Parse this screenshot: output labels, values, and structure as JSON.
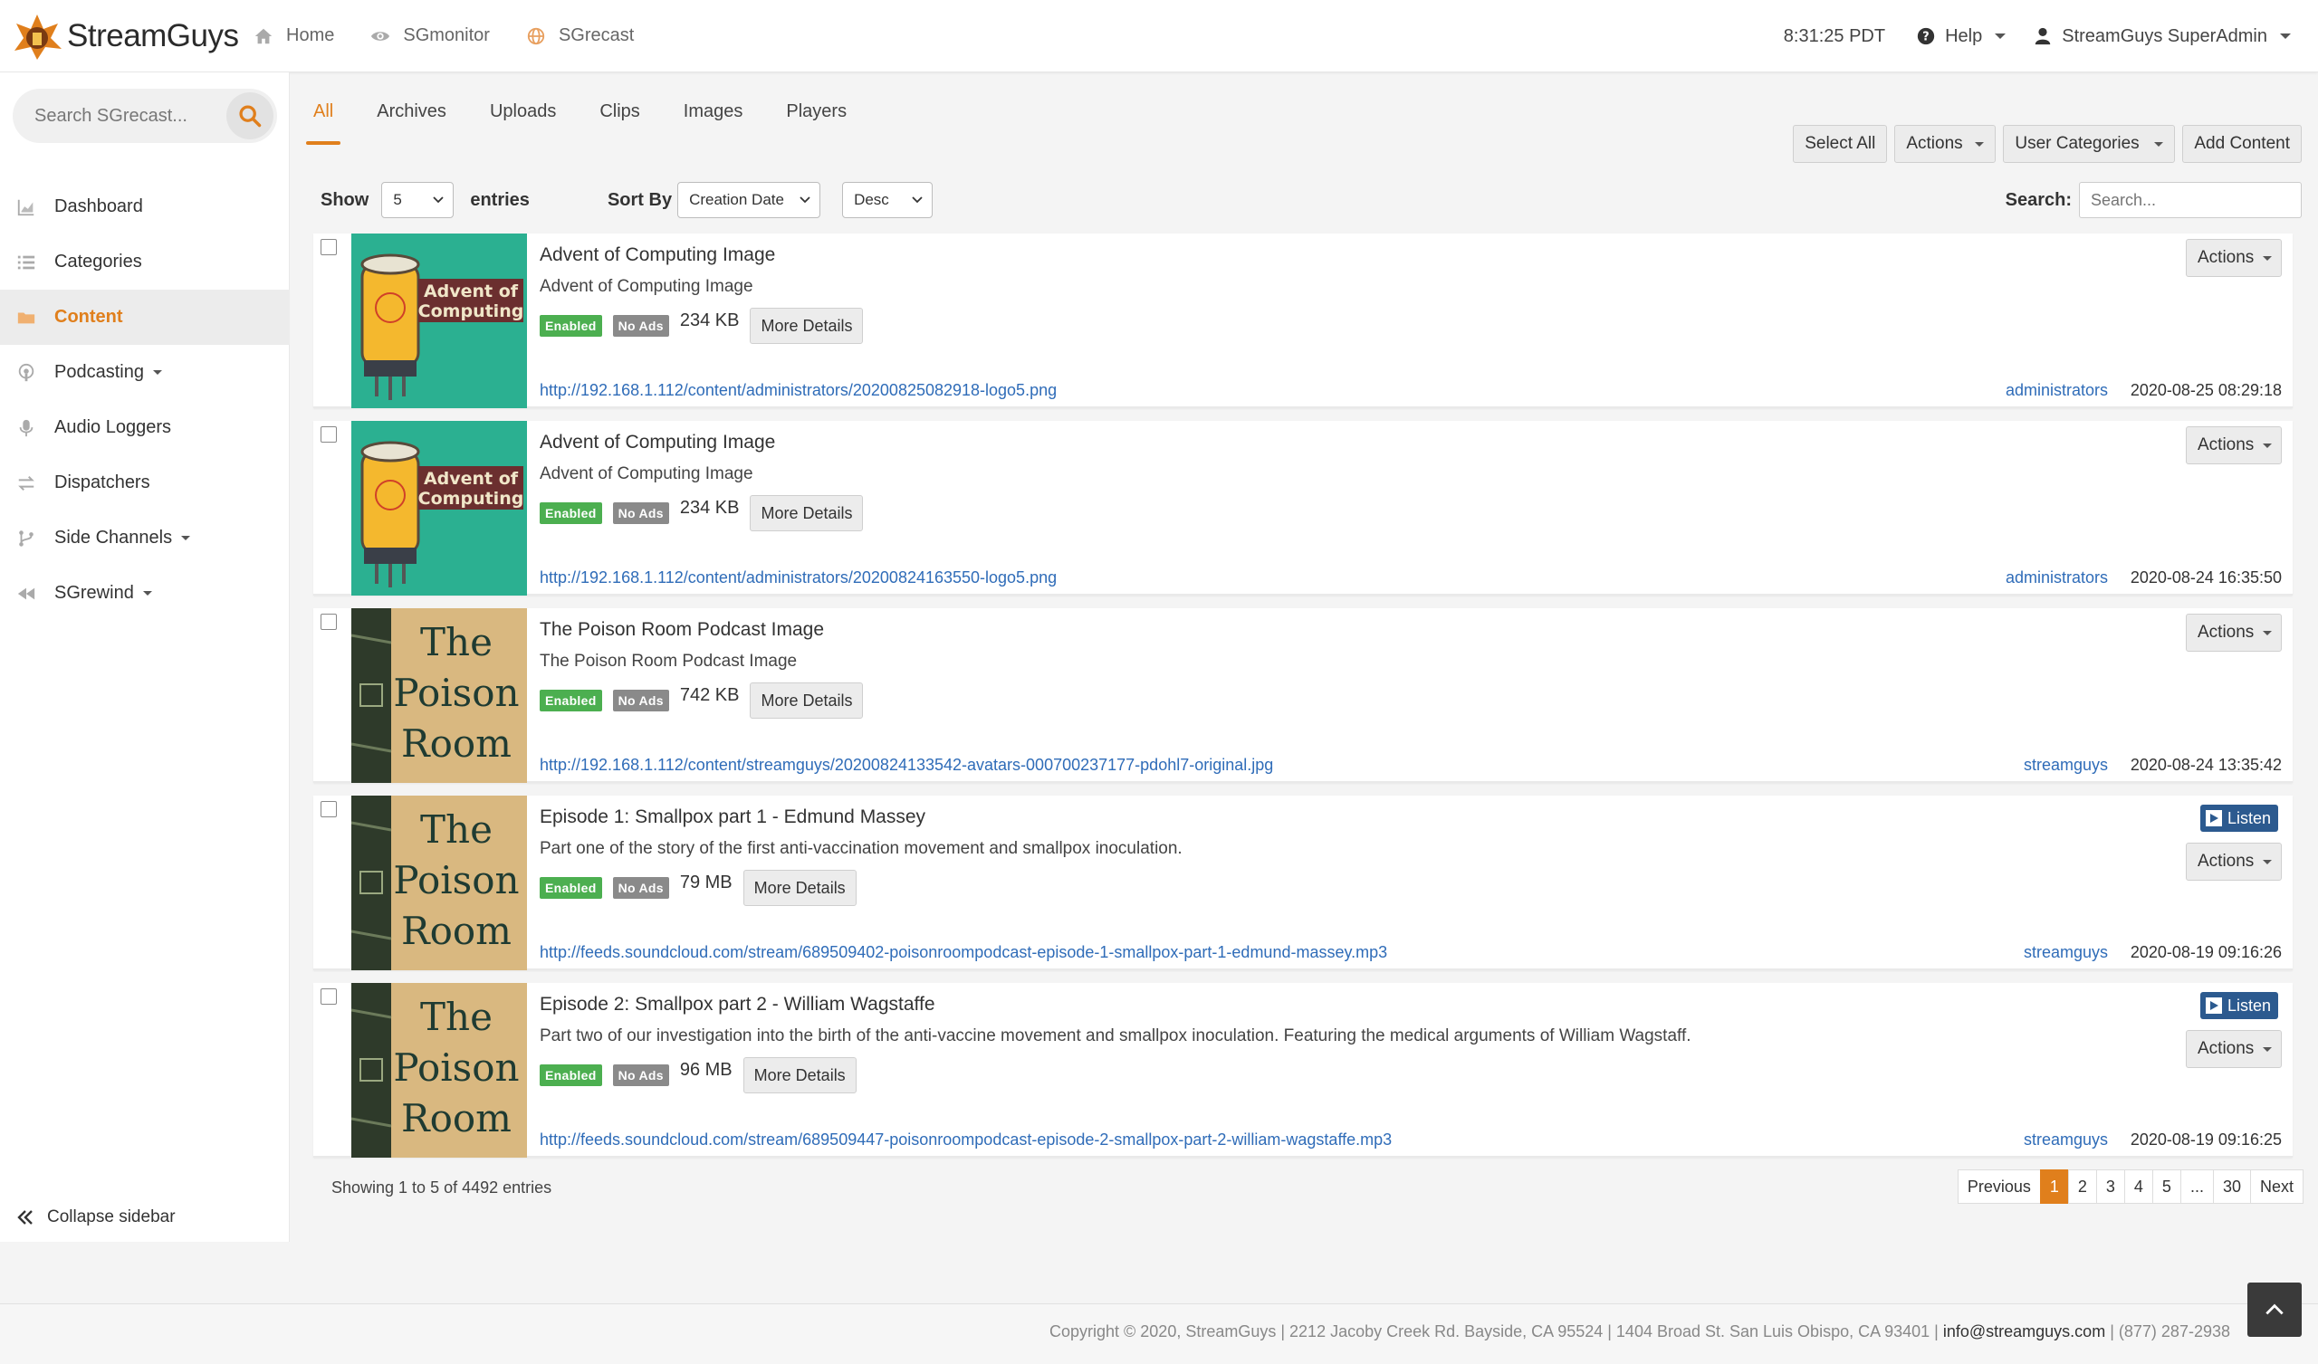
{
  "app": {
    "brand": "StreamGuys"
  },
  "topnav": [
    {
      "label": "Home",
      "icon": "home-icon"
    },
    {
      "label": "SGmonitor",
      "icon": "eye-icon"
    },
    {
      "label": "SGrecast",
      "icon": "globe-icon"
    }
  ],
  "topright": {
    "clock": "8:31:25 PDT",
    "help": "Help",
    "user": "StreamGuys SuperAdmin"
  },
  "sidebar": {
    "search_placeholder": "Search SGrecast...",
    "items": [
      {
        "label": "Dashboard",
        "icon": "chart-icon"
      },
      {
        "label": "Categories",
        "icon": "list-icon"
      },
      {
        "label": "Content",
        "icon": "folder-icon",
        "active": true
      },
      {
        "label": "Podcasting",
        "icon": "podcast-icon",
        "dropdown": true
      },
      {
        "label": "Audio Loggers",
        "icon": "microphone-icon"
      },
      {
        "label": "Dispatchers",
        "icon": "exchange-icon"
      },
      {
        "label": "Side Channels",
        "icon": "branch-icon",
        "dropdown": true
      },
      {
        "label": "SGrewind",
        "icon": "rewind-icon",
        "dropdown": true
      }
    ],
    "collapse_label": "Collapse sidebar"
  },
  "tabs": [
    "All",
    "Archives",
    "Uploads",
    "Clips",
    "Images",
    "Players"
  ],
  "toolbar": {
    "select_all": "Select All",
    "actions": "Actions",
    "user_categories": "User Categories",
    "add_content": "Add Content"
  },
  "filters": {
    "show_label": "Show",
    "show_value": "5",
    "entries_label": "entries",
    "sort_label": "Sort By",
    "sort_value": "Creation Date",
    "order_value": "Desc",
    "search_label": "Search:",
    "search_placeholder": "Search..."
  },
  "badges": {
    "enabled": "Enabled",
    "no_ads": "No Ads"
  },
  "labels": {
    "more_details": "More Details",
    "actions": "Actions",
    "listen": "Listen"
  },
  "thumbs": {
    "aoc_line1": "Advent of",
    "aoc_line2": "Computing",
    "pr_line1": "The",
    "pr_line2": "Poison",
    "pr_line3": "Room"
  },
  "rows": [
    {
      "title": "Advent of Computing Image",
      "desc": "Advent of Computing Image",
      "size": "234 KB",
      "url": "http://192.168.1.112/content/administrators/20200825082918-logo5.png",
      "owner": "administrators",
      "date": "2020-08-25 08:29:18"
    },
    {
      "title": "Advent of Computing Image",
      "desc": "Advent of Computing Image",
      "size": "234 KB",
      "url": "http://192.168.1.112/content/administrators/20200824163550-logo5.png",
      "owner": "administrators",
      "date": "2020-08-24 16:35:50"
    },
    {
      "title": "The Poison Room Podcast Image",
      "desc": "The Poison Room Podcast Image",
      "size": "742 KB",
      "url": "http://192.168.1.112/content/streamguys/20200824133542-avatars-000700237177-pdohl7-original.jpg",
      "owner": "streamguys",
      "date": "2020-08-24 13:35:42"
    },
    {
      "title": "Episode 1: Smallpox part 1 - Edmund Massey",
      "desc": "Part one of the story of the first anti-vaccination movement and smallpox inoculation.",
      "size": "79 MB",
      "url": "http://feeds.soundcloud.com/stream/689509402-poisonroompodcast-episode-1-smallpox-part-1-edmund-massey.mp3",
      "owner": "streamguys",
      "date": "2020-08-19 09:16:26"
    },
    {
      "title": "Episode 2: Smallpox part 2 - William Wagstaffe",
      "desc": "Part two of our investigation into the birth of the anti-vaccine movement and smallpox inoculation. Featuring the medical arguments of William Wagstaff.",
      "size": "96 MB",
      "url": "http://feeds.soundcloud.com/stream/689509447-poisonroompodcast-episode-2-smallpox-part-2-william-wagstaffe.mp3",
      "owner": "streamguys",
      "date": "2020-08-19 09:16:25"
    }
  ],
  "showing": "Showing 1 to 5 of 4492 entries",
  "pagination": {
    "previous": "Previous",
    "pages": [
      "1",
      "2",
      "3",
      "4",
      "5",
      "...",
      "30"
    ],
    "next": "Next",
    "current": "1"
  },
  "footer": {
    "copyright": "Copyright © 2020, StreamGuys | 2212 Jacoby Creek Rd. Bayside, CA 95524 | 1404 Broad St. San Luis Obispo, CA 93401 |",
    "email": "info@streamguys.com",
    "phone": "| (877) 287-2938"
  },
  "colors": {
    "accent": "#e07f1c",
    "link": "#2f6cb8",
    "enabled": "#4caf50",
    "listen": "#2c5a8f"
  }
}
